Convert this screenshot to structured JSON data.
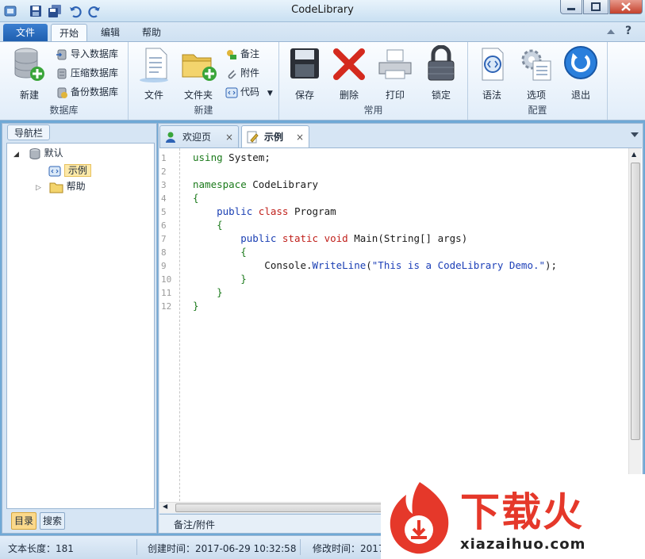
{
  "app": {
    "title": "CodeLibrary"
  },
  "ribbon_tabs": {
    "file": "文件",
    "start": "开始",
    "edit": "编辑",
    "help": "帮助"
  },
  "ribbon": {
    "groups": {
      "database": {
        "label": "数据库",
        "new": "新建",
        "import": "导入数据库",
        "compress": "压缩数据库",
        "backup": "备份数据库"
      },
      "new": {
        "label": "新建",
        "file": "文件",
        "folder": "文件夹",
        "note": "备注",
        "attachment": "附件",
        "code": "代码"
      },
      "common": {
        "label": "常用",
        "save": "保存",
        "delete": "删除",
        "print": "打印",
        "lock": "锁定"
      },
      "config": {
        "label": "配置",
        "syntax": "语法",
        "options": "选项",
        "exit": "退出"
      }
    }
  },
  "nav": {
    "title": "导航栏",
    "tree": {
      "root": "默认",
      "child_selected": "示例",
      "child_help": "帮助"
    },
    "bottom_tabs": {
      "directory": "目录",
      "search": "搜索"
    }
  },
  "doc_tabs": [
    {
      "label": "欢迎页",
      "close": "×"
    },
    {
      "label": "示例",
      "close": "×"
    }
  ],
  "editor": {
    "line_numbers": [
      "1",
      "2",
      "3",
      "4",
      "5",
      "6",
      "7",
      "8",
      "9",
      "10",
      "11",
      "12"
    ],
    "notes_label": "备注/附件"
  },
  "status": {
    "text_length": "文本长度：181",
    "created": "创建时间：2017-06-29 10:32:58",
    "modified": "修改时间：2017"
  },
  "watermark": {
    "brand": "下载火",
    "domain": "xiazaihuo.com"
  }
}
